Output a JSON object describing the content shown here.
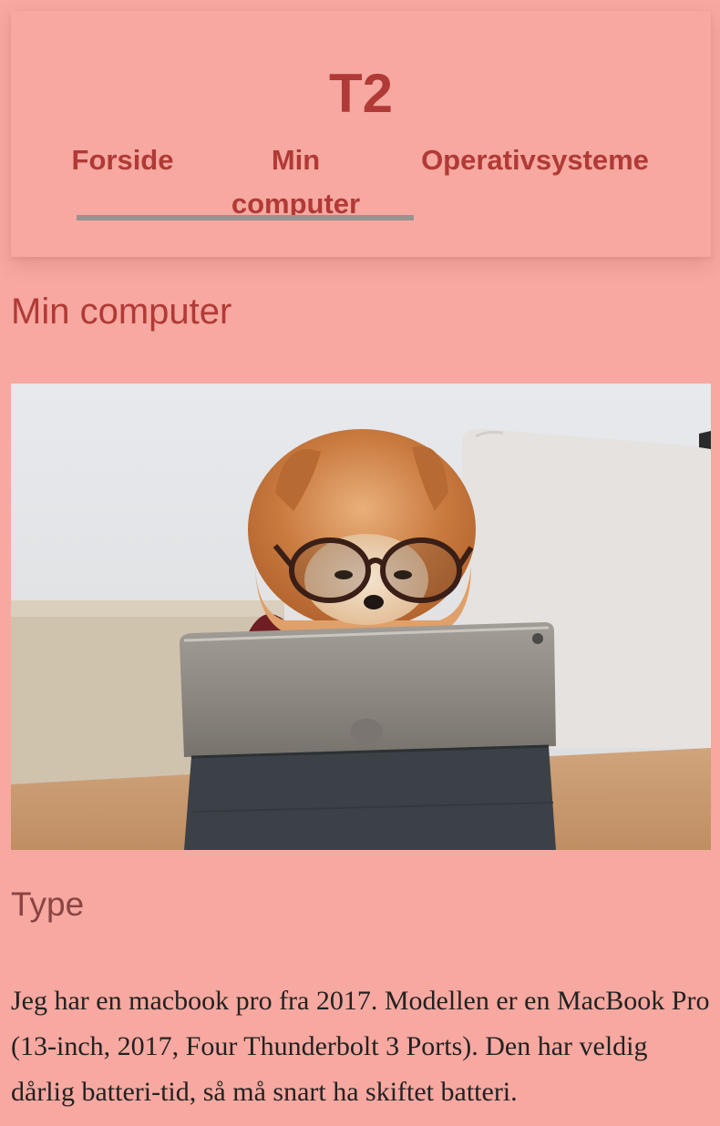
{
  "header": {
    "site_title": "T2",
    "nav": [
      {
        "label": "Forside",
        "active": false
      },
      {
        "label": "Min computer",
        "active": true
      },
      {
        "label": "Operativsysteme",
        "active": false
      }
    ]
  },
  "main": {
    "title": "Min computer",
    "image": {
      "subject": "dog-wearing-glasses-using-tablet"
    },
    "section_title": "Type",
    "paragraph": "Jeg har en macbook pro fra 2017. Modellen er en MacBook Pro (13-inch, 2017, Four Thunderbolt 3 Ports). Den har veldig dårlig batteri-tid, så må snart ha skiftet batteri."
  },
  "colors": {
    "background": "#f7a8a0",
    "accent": "#b03a36",
    "nav_underline": "#999390",
    "section_heading": "#8a4543",
    "text": "#222222"
  }
}
